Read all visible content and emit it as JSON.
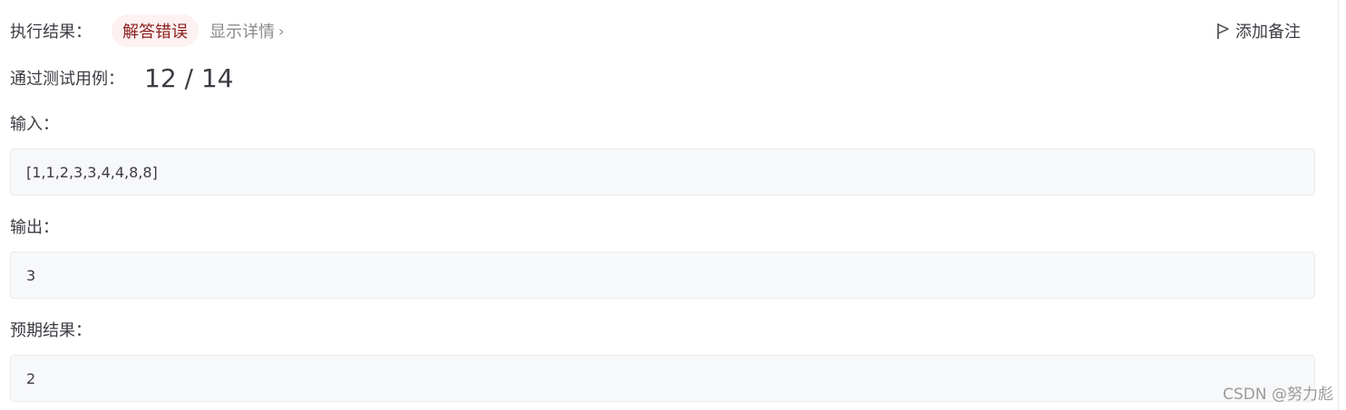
{
  "result": {
    "label": "执行结果：",
    "status": "解答错误",
    "details_link": "显示详情",
    "chevron": "›"
  },
  "note_button": {
    "label": "添加备注",
    "icon": "flag-icon"
  },
  "tests": {
    "label": "通过测试用例：",
    "count": "12 / 14"
  },
  "input": {
    "label": "输入：",
    "value": "[1,1,2,3,3,4,4,8,8]"
  },
  "output": {
    "label": "输出：",
    "value": "3"
  },
  "expected": {
    "label": "预期结果：",
    "value": "2"
  },
  "watermark": "CSDN @努力彪",
  "colors": {
    "error_badge_bg": "#fdf1f1",
    "error_badge_text": "#8b1e1e",
    "box_bg": "#f7f8fa"
  }
}
